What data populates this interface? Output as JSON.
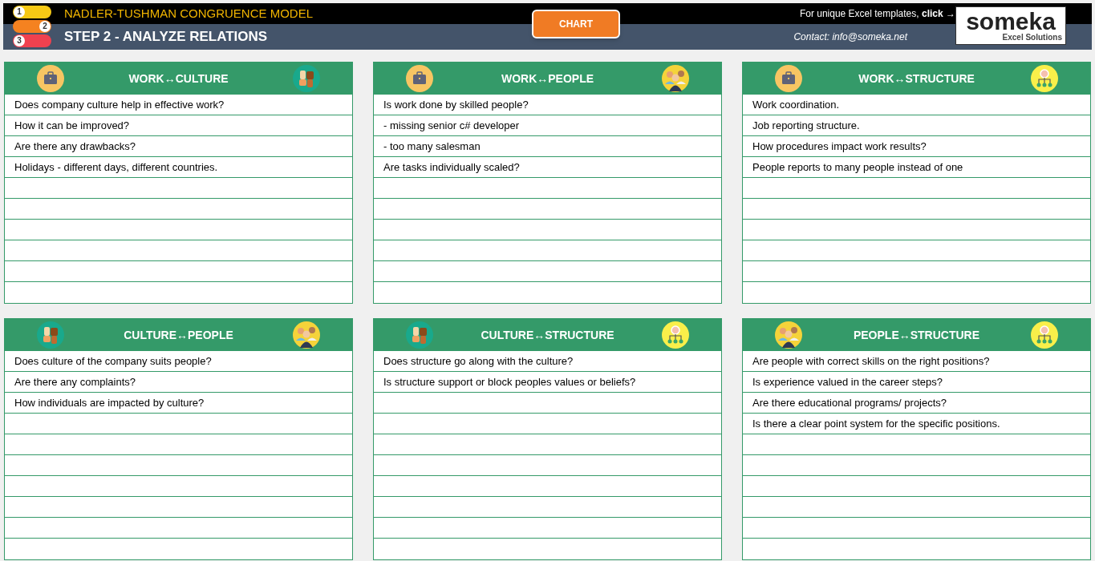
{
  "header": {
    "steps": [
      {
        "number": "1",
        "color": "#f6c915"
      },
      {
        "number": "2",
        "color": "#f58220"
      },
      {
        "number": "3",
        "color": "#f0414f"
      }
    ],
    "title": "NADLER-TUSHMAN CONGRUENCE MODEL",
    "subtitle": "STEP 2 - ANALYZE RELATIONS",
    "chart_button": "CHART",
    "promo": "For unique Excel templates, **click →**",
    "contact": "Contact: info@someka.net",
    "logo": {
      "name": "someka",
      "tagline": "Excel Solutions"
    }
  },
  "panels": [
    {
      "title": "WORK↔CULTURE",
      "icons": [
        {
          "kind": "work"
        },
        {
          "kind": "culture"
        }
      ],
      "rows": [
        "Does company culture help in effective work?",
        "How it can be improved?",
        "Are there any drawbacks?",
        "Holidays - different days, different countries."
      ]
    },
    {
      "title": "WORK↔PEOPLE",
      "icons": [
        {
          "kind": "work"
        },
        {
          "kind": "people"
        }
      ],
      "rows": [
        "Is work done by skilled people?",
        "- missing senior c# developer",
        "- too many salesman",
        "Are tasks individually scaled?"
      ]
    },
    {
      "title": "WORK↔STRUCTURE",
      "icons": [
        {
          "kind": "work"
        },
        {
          "kind": "structure"
        }
      ],
      "rows": [
        "Work coordination.",
        "Job reporting structure.",
        "How procedures impact work results?",
        "People reports to many people instead of one"
      ]
    },
    {
      "title": "CULTURE↔PEOPLE",
      "icons": [
        {
          "kind": "culture"
        },
        {
          "kind": "people"
        }
      ],
      "rows": [
        "Does culture of the company suits people?",
        "Are there any complaints?",
        "How individuals are impacted by culture?"
      ]
    },
    {
      "title": "CULTURE↔STRUCTURE",
      "icons": [
        {
          "kind": "culture"
        },
        {
          "kind": "structure"
        }
      ],
      "rows": [
        "Does structure go along with the culture?",
        "Is structure support or block peoples values or beliefs?"
      ]
    },
    {
      "title": "PEOPLE↔STRUCTURE",
      "icons": [
        {
          "kind": "people"
        },
        {
          "kind": "structure"
        }
      ],
      "rows": [
        "Are people with correct skills on the right positions?",
        "Is experience valued in the career steps?",
        "Are there educational programs/ projects?",
        "Is there a clear point system for the specific positions."
      ]
    }
  ]
}
